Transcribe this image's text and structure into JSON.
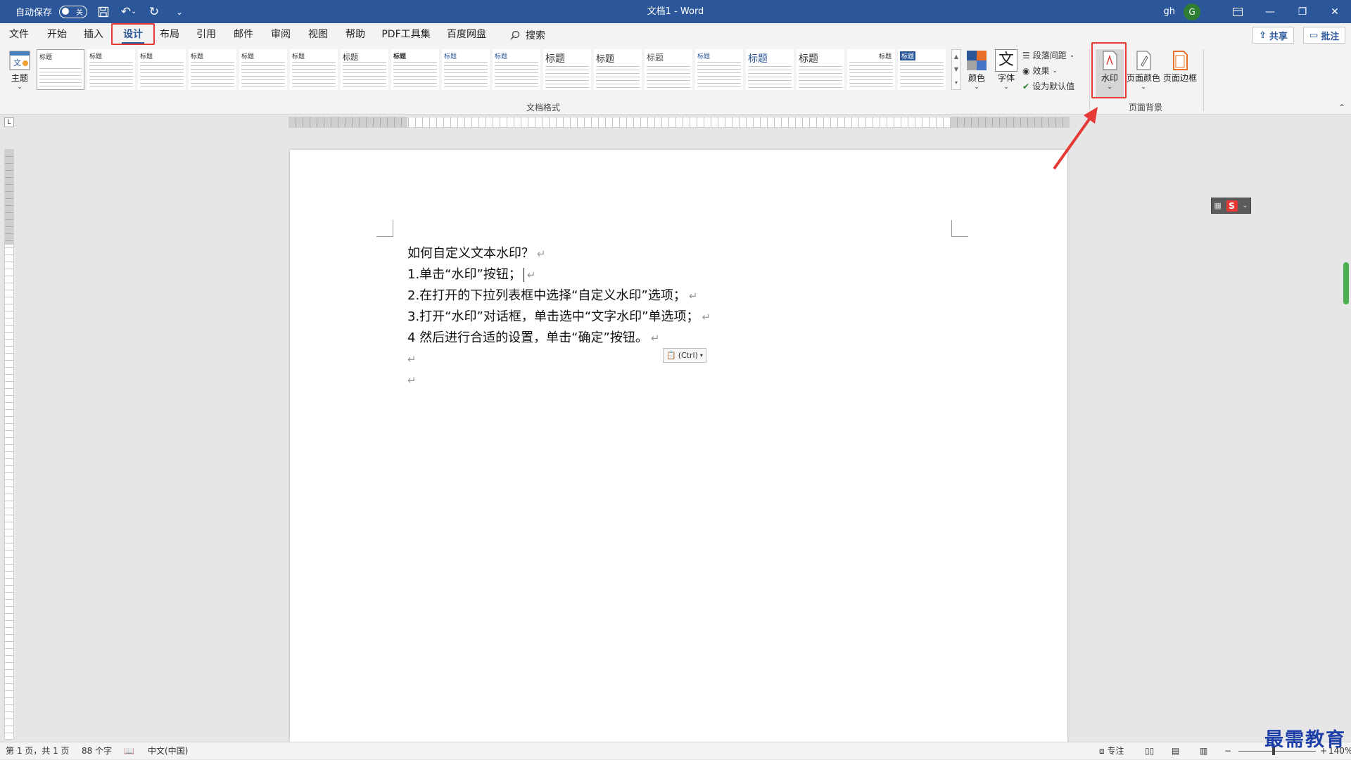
{
  "titlebar": {
    "autosave_label": "自动保存",
    "autosave_state": "关",
    "doc_title": "文档1 - Word",
    "user": "gh",
    "avatar_letter": "G"
  },
  "tabs": [
    "文件",
    "开始",
    "插入",
    "设计",
    "布局",
    "引用",
    "邮件",
    "审阅",
    "视图",
    "帮助",
    "PDF工具集",
    "百度网盘"
  ],
  "search_label": "搜索",
  "share_label": "共享",
  "comment_label": "批注",
  "ribbon": {
    "theme_label": "主题",
    "gallery_title_sample": "标题",
    "heading1_sample": "标题 1",
    "group_doc_format": "文档格式",
    "colors_label": "颜色",
    "fonts_label": "字体",
    "fonts_glyph": "文",
    "para_spacing_label": "段落间距",
    "effects_label": "效果",
    "set_default_label": "设为默认值",
    "watermark_label": "水印",
    "page_color_label": "页面颜色",
    "page_border_label": "页面边框",
    "group_page_bg": "页面背景"
  },
  "document": {
    "lines": [
      "如何自定义文本水印？",
      "1.单击“水印”按钮；",
      "2.在打开的下拉列表框中选择“自定义水印”选项；",
      "3.打开“水印”对话框，单击选中“文字水印”单选项；",
      "4 然后进行合适的设置，单击“确定”按钮。",
      "",
      ""
    ],
    "paste_label": "(Ctrl)"
  },
  "status": {
    "page": "第 1 页，共 1 页",
    "words": "88 个字",
    "lang": "中文(中国)",
    "focus": "专注",
    "zoom": "140%"
  },
  "watermark_text": "最需教育",
  "colors": {
    "accent": "#2b579a",
    "highlight": "#e53935",
    "watermark": "#1e3ea8"
  }
}
